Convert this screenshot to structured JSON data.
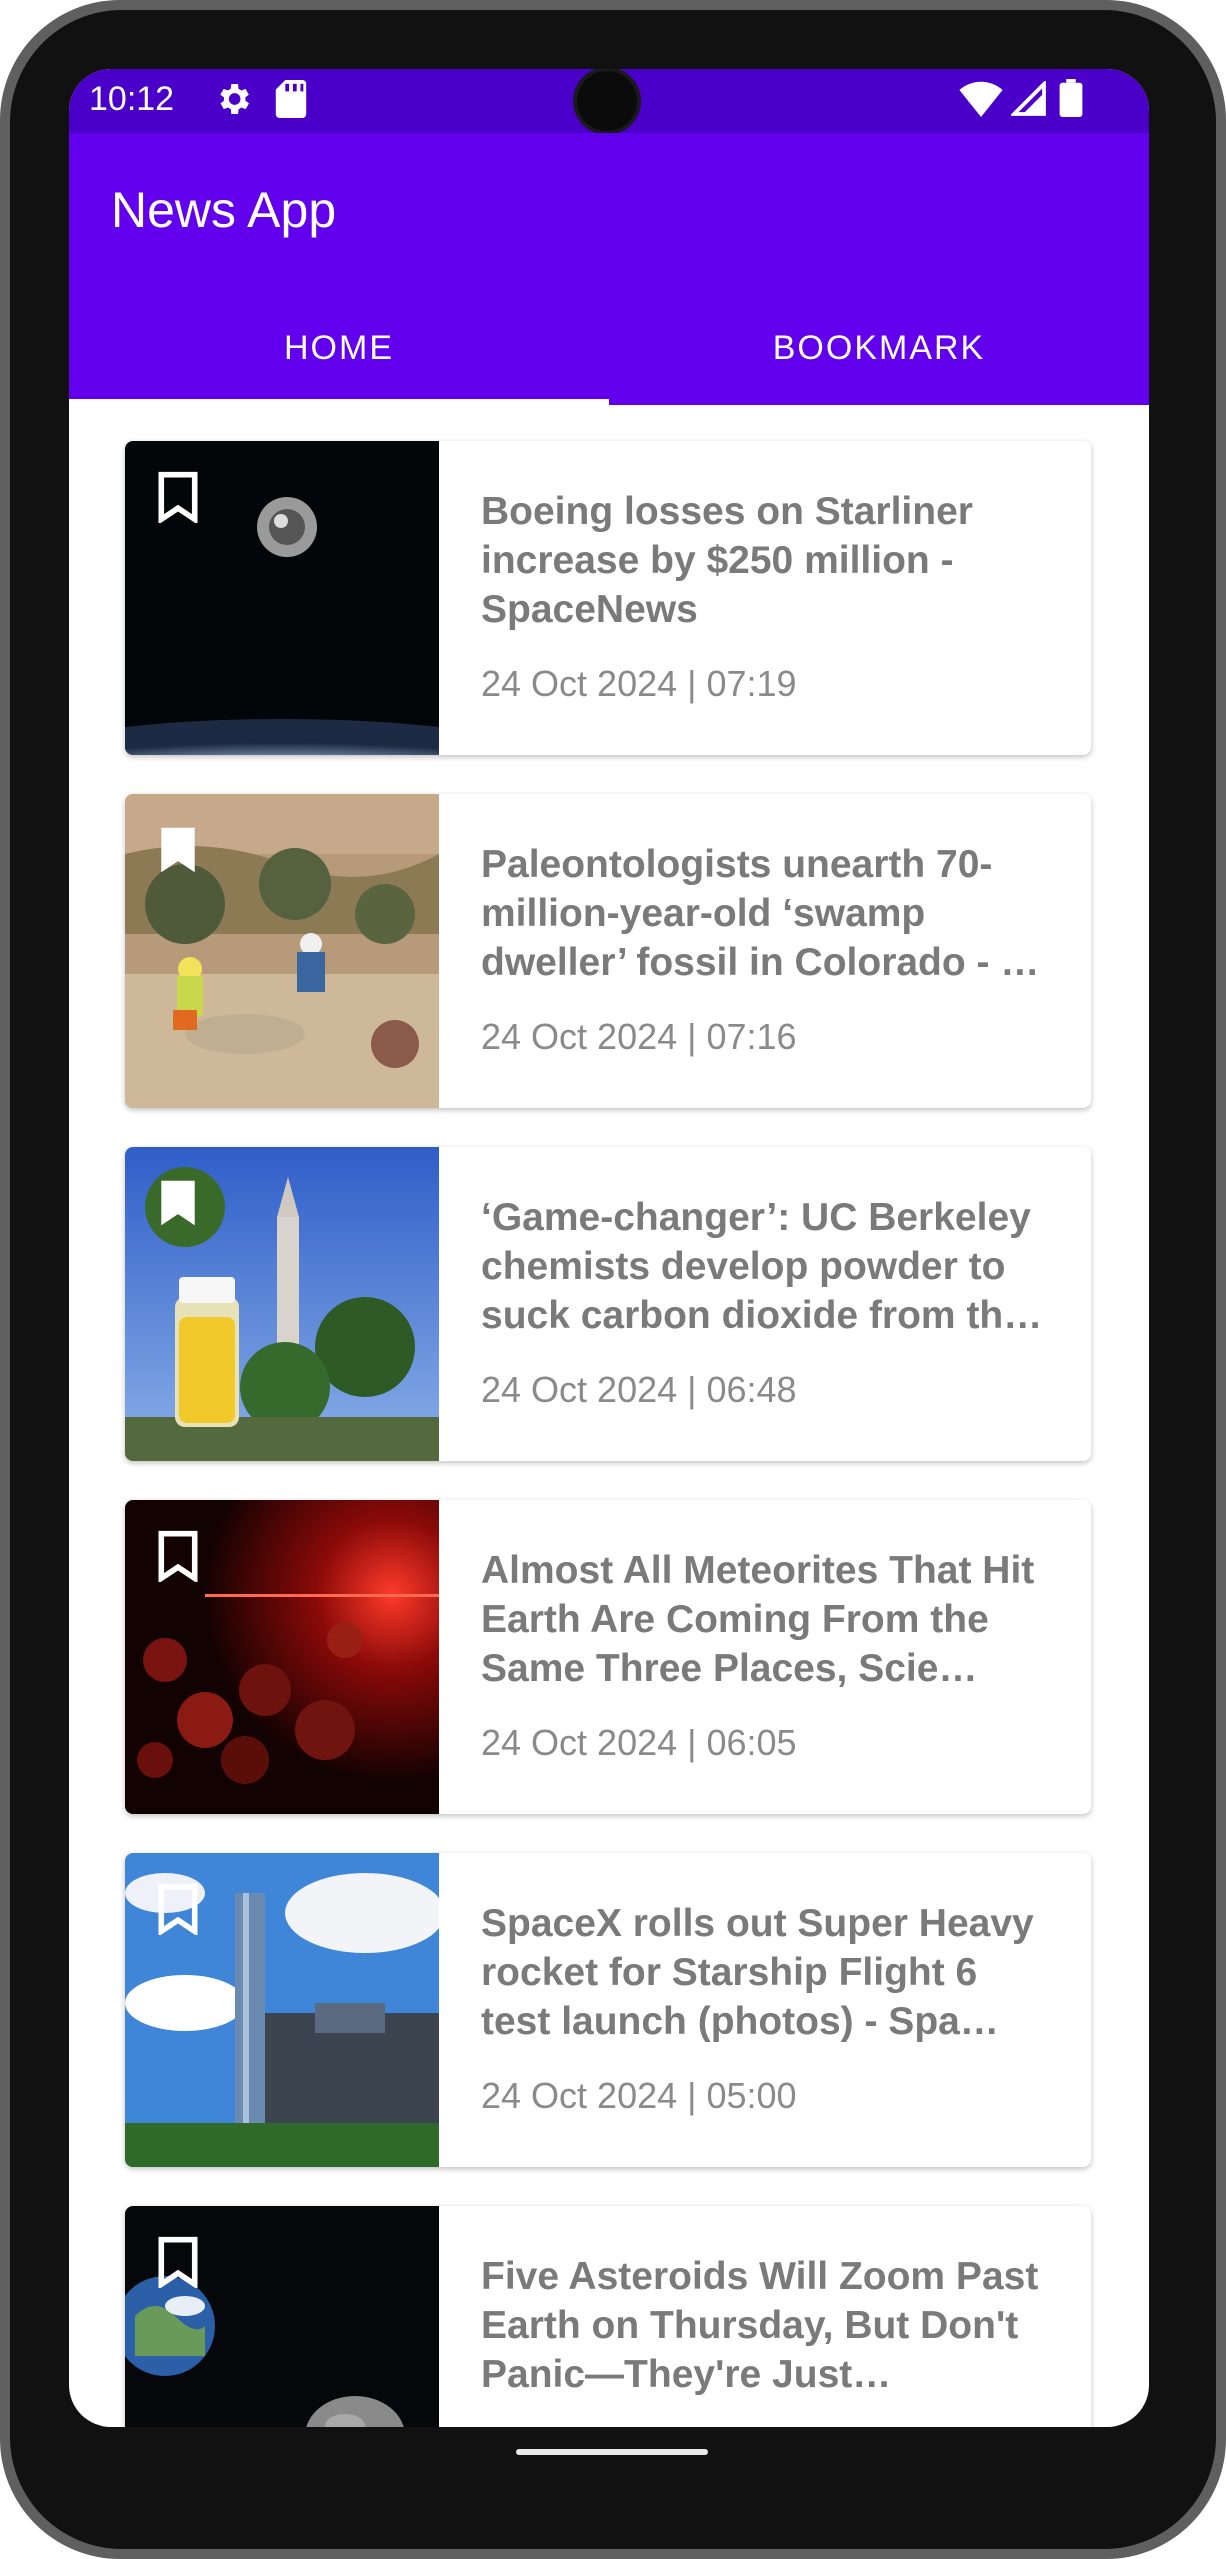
{
  "status": {
    "time": "10:12"
  },
  "app": {
    "title": "News App"
  },
  "tabs": {
    "home": "HOME",
    "bookmark": "BOOKMARK"
  },
  "articles": [
    {
      "headline": "Boeing losses on Starliner increase by $250 million - SpaceNews",
      "date": "24 Oct 2024 | 07:19",
      "bookmark_icon": "bookmark-outline-icon"
    },
    {
      "headline": "Paleontologists unearth 70-million-year-old ‘swamp dweller’ fossil in Colorado - …",
      "date": "24 Oct 2024 | 07:16",
      "bookmark_icon": "bookmark-filled-icon"
    },
    {
      "headline": "‘Game-changer’: UC Berkeley chemists develop powder to suck carbon dioxide from th…",
      "date": "24 Oct 2024 | 06:48",
      "bookmark_icon": "bookmark-filled-icon"
    },
    {
      "headline": "Almost All Meteorites That Hit Earth Are Coming From the Same Three Places, Scie…",
      "date": "24 Oct 2024 | 06:05",
      "bookmark_icon": "bookmark-outline-icon"
    },
    {
      "headline": "SpaceX rolls out Super Heavy rocket for Starship Flight 6 test launch (photos) - Spa…",
      "date": "24 Oct 2024 | 05:00",
      "bookmark_icon": "bookmark-outline-icon"
    },
    {
      "headline": "Five Asteroids Will Zoom Past Earth on Thursday, But Don't Panic—They're Just Passing…",
      "date": "",
      "bookmark_icon": "bookmark-outline-icon"
    }
  ],
  "colors": {
    "status_bar": "#4a00c8",
    "app_bar": "#6200ee",
    "text_grey": "#7a7a7a"
  }
}
